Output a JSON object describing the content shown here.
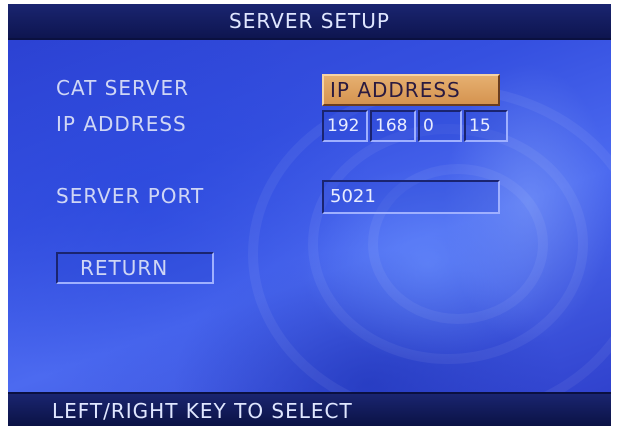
{
  "header": {
    "title": "SERVER SETUP"
  },
  "cat_server": {
    "label": "CAT SERVER",
    "value": "IP ADDRESS"
  },
  "ip_address": {
    "label": "IP ADDRESS",
    "octets": [
      "192",
      "168",
      "0",
      "15"
    ]
  },
  "server_port": {
    "label": "SERVER PORT",
    "value": "5021"
  },
  "return_button": {
    "label": "RETURN"
  },
  "footer": {
    "hint": "LEFT/RIGHT KEY TO SELECT"
  },
  "colors": {
    "background": "#3550e0",
    "bar": "#121a5a",
    "selected": "#e0a860",
    "text": "#cfd6f5"
  }
}
